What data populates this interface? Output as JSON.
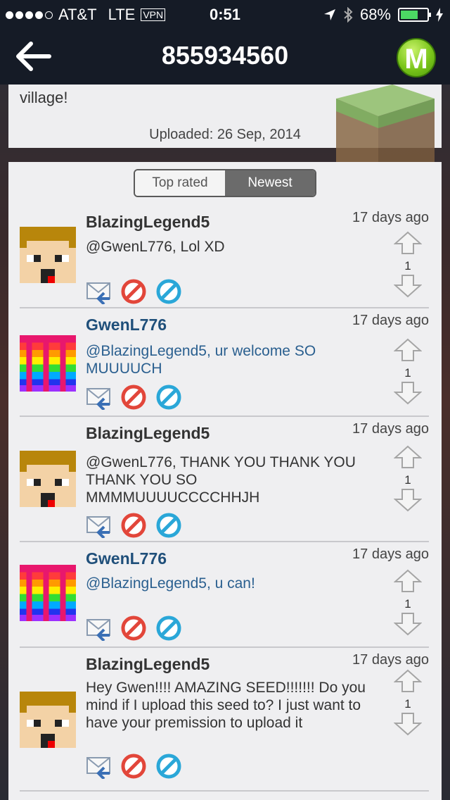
{
  "status": {
    "carrier": "AT&T",
    "network": "LTE",
    "vpn": "VPN",
    "time": "0:51",
    "battery": "68%",
    "battery_level": 0.68
  },
  "nav": {
    "title": "855934560",
    "logo_letter": "M"
  },
  "seed": {
    "description_tail": "village!",
    "uploaded": "Uploaded: 26 Sep, 2014"
  },
  "tabs": {
    "top_rated": "Top rated",
    "newest": "Newest"
  },
  "comments": [
    {
      "author": "BlazingLegend5",
      "time": "17 days ago",
      "text": "@GwenL776, Lol XD",
      "votes": "1",
      "avatar": "steve"
    },
    {
      "author": "GwenL776",
      "time": "17 days ago",
      "text": "@BlazingLegend5, ur welcome SO MUUUUCH",
      "votes": "1",
      "avatar": "rainbow"
    },
    {
      "author": "BlazingLegend5",
      "time": "17 days ago",
      "text": "@GwenL776, THANK YOU THANK YOU THANK YOU SO MMMMUUUUCCCCHHJH",
      "votes": "1",
      "avatar": "steve"
    },
    {
      "author": "GwenL776",
      "time": "17 days ago",
      "text": "@BlazingLegend5, u can!",
      "votes": "1",
      "avatar": "rainbow"
    },
    {
      "author": "BlazingLegend5",
      "time": "17 days ago",
      "text": "Hey Gwen!!!! AMAZING SEED!!!!!!! Do you mind if I upload this seed to? I just want to have your premission to upload it",
      "votes": "1",
      "avatar": "steve"
    }
  ],
  "colors": {
    "bar_bg": "#151b26",
    "author_blue": "#1f4f7a",
    "battery_green": "#4cd964"
  }
}
